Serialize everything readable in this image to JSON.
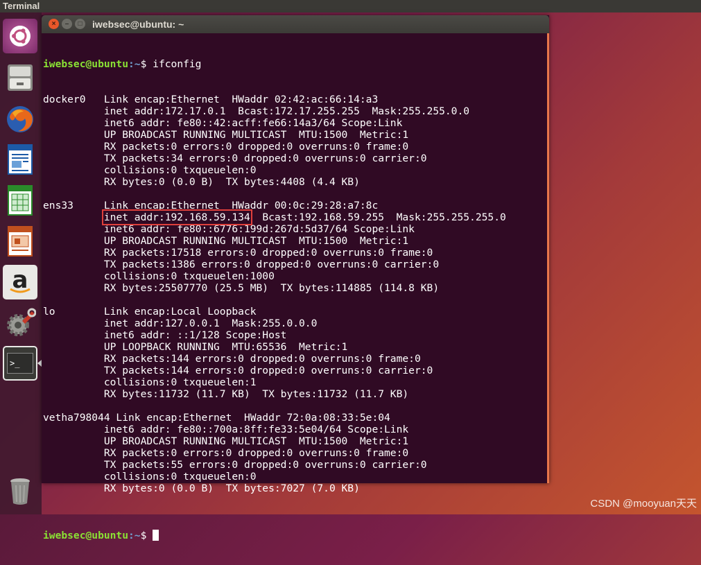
{
  "top_panel": {
    "app_name": "Terminal"
  },
  "launcher": {
    "items": [
      {
        "name": "ubuntu-dash-icon"
      },
      {
        "name": "files-icon"
      },
      {
        "name": "firefox-icon"
      },
      {
        "name": "libreoffice-writer-icon"
      },
      {
        "name": "libreoffice-calc-icon"
      },
      {
        "name": "libreoffice-impress-icon"
      },
      {
        "name": "amazon-icon"
      },
      {
        "name": "system-settings-icon"
      },
      {
        "name": "terminal-icon"
      },
      {
        "name": "trash-icon"
      }
    ],
    "amazon_glyph": "a",
    "terminal_glyph": ">_"
  },
  "window": {
    "title": "iwebsec@ubuntu: ~",
    "close_glyph": "×",
    "min_glyph": "–",
    "max_glyph": "□"
  },
  "terminal": {
    "prompt_user": "iwebsec@ubuntu",
    "prompt_path": ":~",
    "prompt_symbol": "$ ",
    "command": "ifconfig",
    "lines": [
      "docker0   Link encap:Ethernet  HWaddr 02:42:ac:66:14:a3",
      "          inet addr:172.17.0.1  Bcast:172.17.255.255  Mask:255.255.0.0",
      "          inet6 addr: fe80::42:acff:fe66:14a3/64 Scope:Link",
      "          UP BROADCAST RUNNING MULTICAST  MTU:1500  Metric:1",
      "          RX packets:0 errors:0 dropped:0 overruns:0 frame:0",
      "          TX packets:34 errors:0 dropped:0 overruns:0 carrier:0",
      "          collisions:0 txqueuelen:0",
      "          RX bytes:0 (0.0 B)  TX bytes:4408 (4.4 KB)",
      "",
      "ens33     Link encap:Ethernet  HWaddr 00:0c:29:28:a7:8c",
      "HIGHLIGHT",
      "          inet6 addr: fe80::6776:199d:267d:5d37/64 Scope:Link",
      "          UP BROADCAST RUNNING MULTICAST  MTU:1500  Metric:1",
      "          RX packets:17518 errors:0 dropped:0 overruns:0 frame:0",
      "          TX packets:1386 errors:0 dropped:0 overruns:0 carrier:0",
      "          collisions:0 txqueuelen:1000",
      "          RX bytes:25507770 (25.5 MB)  TX bytes:114885 (114.8 KB)",
      "",
      "lo        Link encap:Local Loopback",
      "          inet addr:127.0.0.1  Mask:255.0.0.0",
      "          inet6 addr: ::1/128 Scope:Host",
      "          UP LOOPBACK RUNNING  MTU:65536  Metric:1",
      "          RX packets:144 errors:0 dropped:0 overruns:0 frame:0",
      "          TX packets:144 errors:0 dropped:0 overruns:0 carrier:0",
      "          collisions:0 txqueuelen:1",
      "          RX bytes:11732 (11.7 KB)  TX bytes:11732 (11.7 KB)",
      "",
      "vetha798044 Link encap:Ethernet  HWaddr 72:0a:08:33:5e:04",
      "          inet6 addr: fe80::700a:8ff:fe33:5e04/64 Scope:Link",
      "          UP BROADCAST RUNNING MULTICAST  MTU:1500  Metric:1",
      "          RX packets:0 errors:0 dropped:0 overruns:0 frame:0",
      "          TX packets:55 errors:0 dropped:0 overruns:0 carrier:0",
      "          collisions:0 txqueuelen:0",
      "          RX bytes:0 (0.0 B)  TX bytes:7027 (7.0 KB)",
      ""
    ],
    "highlight": {
      "indent": "          ",
      "text": "inet addr:192.168.59.134",
      "rest": "  Bcast:192.168.59.255  Mask:255.255.255.0"
    }
  },
  "watermark": "CSDN @mooyuan天天",
  "colors": {
    "terminal_bg": "#300a24",
    "prompt_user": "#8ae234",
    "prompt_path": "#729fcf",
    "highlight_box": "#e0403c"
  }
}
